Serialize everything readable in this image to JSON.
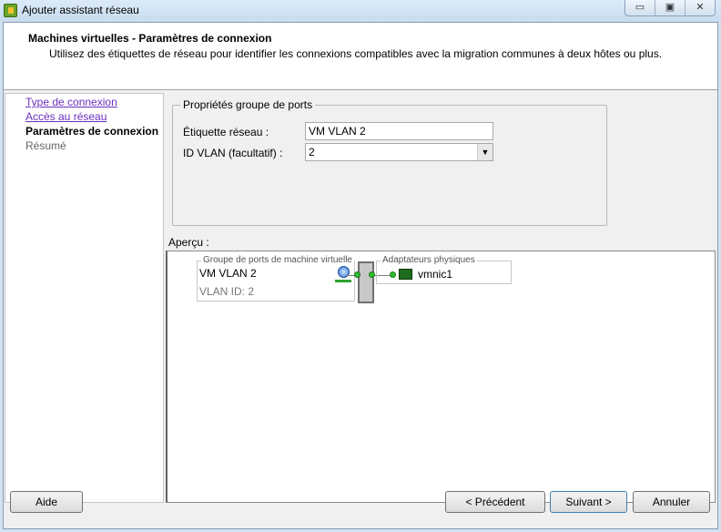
{
  "window": {
    "title": "Ajouter assistant réseau",
    "minimize": "▭",
    "maximize": "▣",
    "close": "✕"
  },
  "header": {
    "title": "Machines virtuelles - Paramètres de connexion",
    "subtitle": "Utilisez des étiquettes de réseau pour identifier les connexions compatibles avec la migration communes à deux hôtes ou plus."
  },
  "nav": [
    "Type de connexion",
    "Accès au réseau",
    "Paramètres de connexion",
    "Résumé"
  ],
  "props": {
    "legend": "Propriétés groupe de ports",
    "label_name": "Étiquette réseau :",
    "label_value": "VM VLAN 2",
    "vlan_name": "ID VLAN (facultatif) :",
    "vlan_value": "2"
  },
  "preview": {
    "label": "Aperçu :",
    "pg_legend": "Groupe de ports de machine virtuelle",
    "pg_name": "VM VLAN 2",
    "pg_vlan": "VLAN ID: 2",
    "pa_legend": "Adaptateurs physiques",
    "nic": "vmnic1"
  },
  "buttons": {
    "help": "Aide",
    "back": "< Précédent",
    "next": "Suivant >",
    "cancel": "Annuler"
  }
}
